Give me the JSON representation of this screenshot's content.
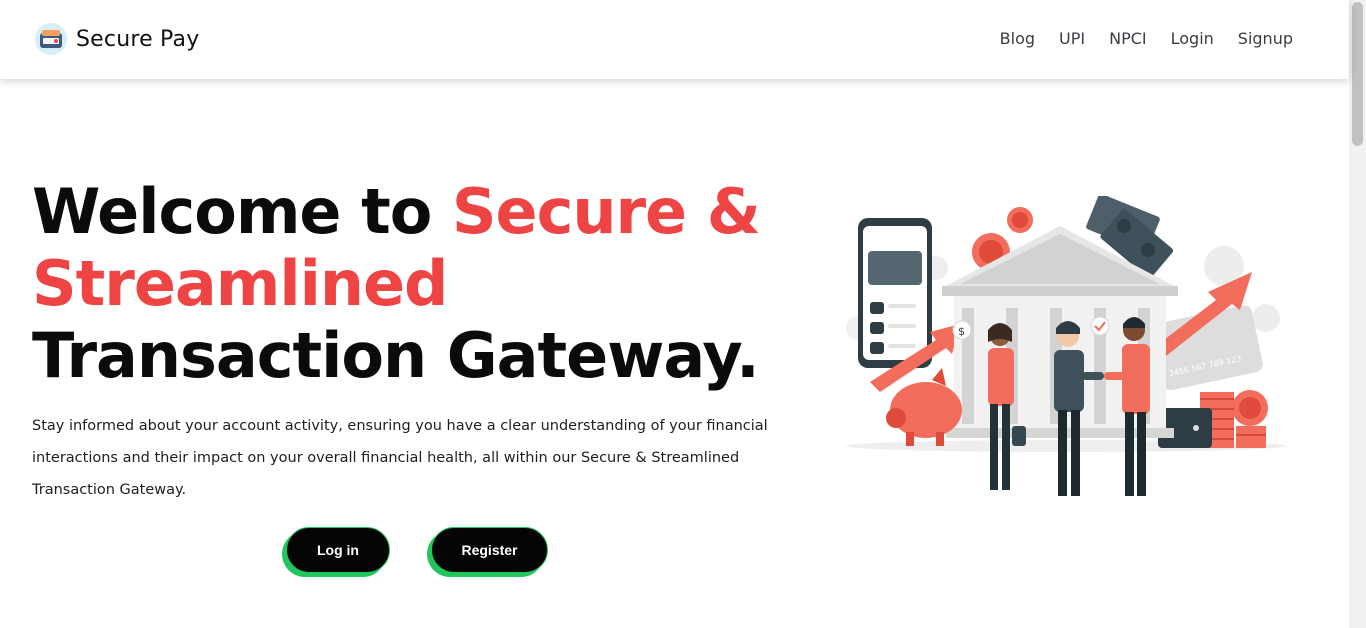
{
  "navbar": {
    "brand_name": "Secure Pay",
    "logo_icon": "wallet-logo-icon",
    "links": [
      "Blog",
      "UPI",
      "NPCI",
      "Login",
      "Signup"
    ]
  },
  "hero": {
    "title_part1": "Welcome to ",
    "title_accent": "Secure & Streamlined",
    "title_part2": " Transaction Gateway.",
    "description": "Stay informed about your account activity, ensuring you have a clear understanding of your financial interactions and their impact on your overall financial health, all within our Secure & Streamlined Transaction Gateway.",
    "login_button": "Log in",
    "register_button": "Register"
  },
  "illustration": {
    "name": "bank-handshake-illustration",
    "card_number": "3456 567 789 123"
  },
  "colors": {
    "accent": "#ee4444",
    "button_bg": "#050505",
    "button_border": "#22c55e",
    "text": "#111111"
  }
}
